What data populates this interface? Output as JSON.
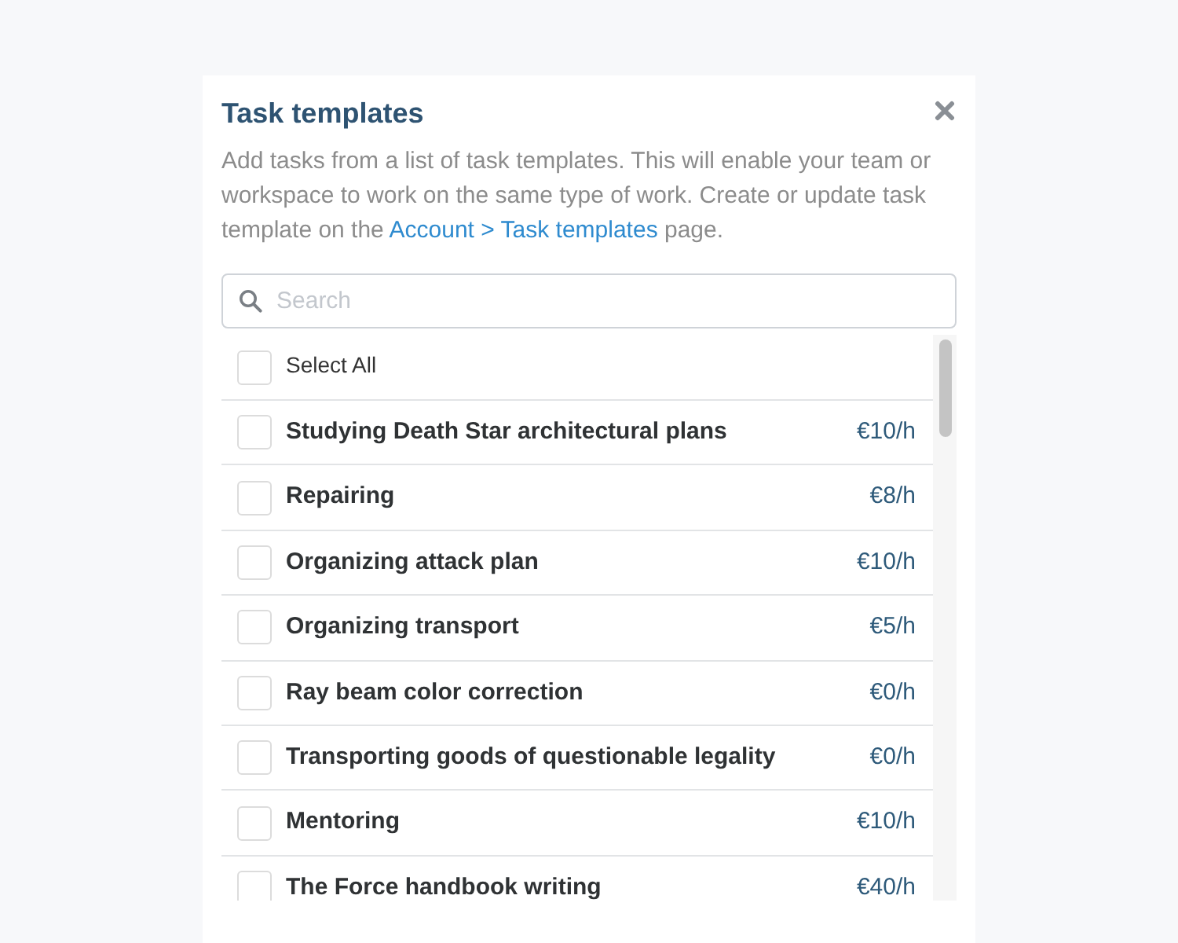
{
  "dialog": {
    "title": "Task templates",
    "description": {
      "before": "Add tasks from a list of task templates. This will enable your team or workspace to work on the same type of work. Create or update task template on the ",
      "link": "Account > Task templates",
      "after": " page."
    }
  },
  "search": {
    "placeholder": "Search"
  },
  "select_all": {
    "label": "Select All",
    "checked": false
  },
  "templates": [
    {
      "name": "Studying Death Star architectural plans",
      "rate": "€10/h",
      "checked": false
    },
    {
      "name": "Repairing",
      "rate": "€8/h",
      "checked": false
    },
    {
      "name": "Organizing attack plan",
      "rate": "€10/h",
      "checked": false
    },
    {
      "name": "Organizing transport",
      "rate": "€5/h",
      "checked": false
    },
    {
      "name": "Ray beam color correction",
      "rate": "€0/h",
      "checked": false
    },
    {
      "name": "Transporting goods of questionable legality",
      "rate": "€0/h",
      "checked": false
    },
    {
      "name": "Mentoring",
      "rate": "€10/h",
      "checked": false
    },
    {
      "name": "The Force handbook writing",
      "rate": "€40/h",
      "checked": false
    }
  ]
}
